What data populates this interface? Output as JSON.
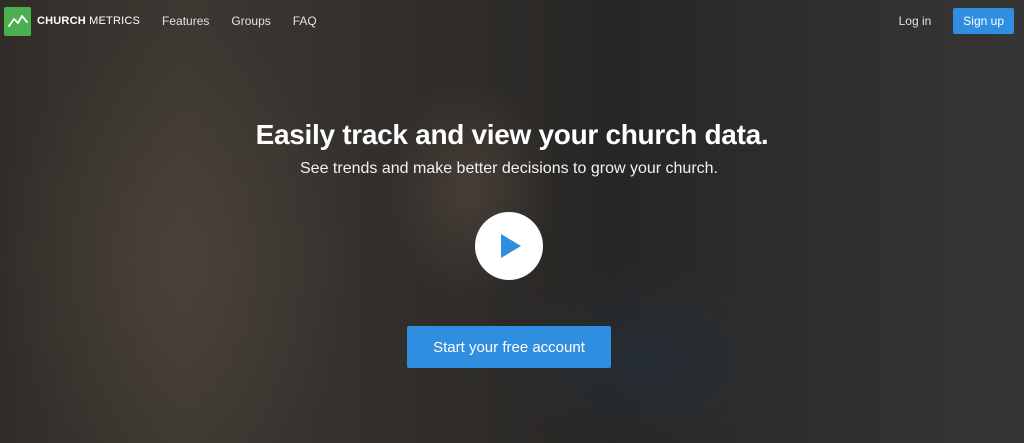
{
  "nav": {
    "logo": {
      "bold": "CHURCH",
      "light": " METRICS",
      "icon": "chart-line-icon",
      "color": "#4caf50"
    },
    "links": [
      "Features",
      "Groups",
      "FAQ"
    ],
    "login_label": "Log in",
    "signup_label": "Sign up"
  },
  "hero": {
    "headline": "Easily track and view your church data.",
    "subhead": "See trends and make better decisions to grow your church.",
    "play_icon": "play-icon",
    "cta_label": "Start your free account",
    "accent_color": "#2f8ee0"
  }
}
